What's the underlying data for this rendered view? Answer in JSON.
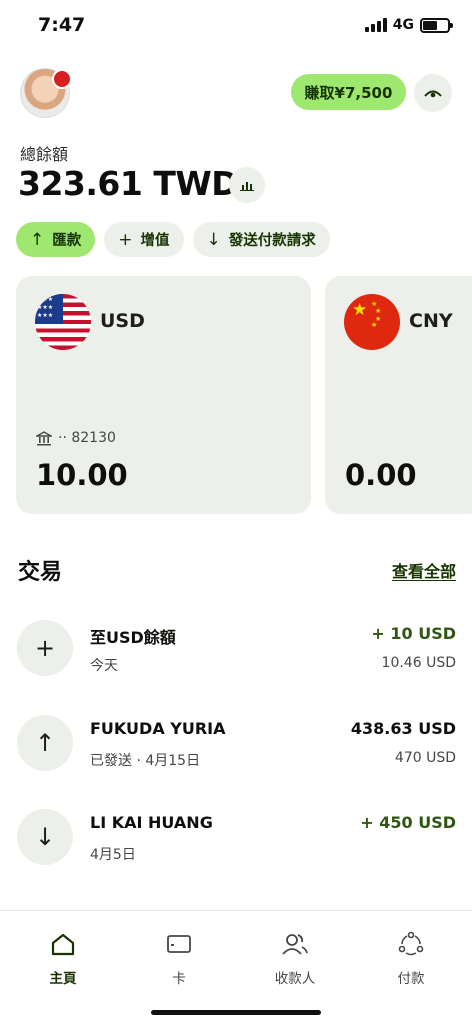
{
  "status_bar": {
    "time": "7:47",
    "network": "4G"
  },
  "header": {
    "earn_label": "賺取¥7,500"
  },
  "balance": {
    "label": "總餘額",
    "amount": "323.61 TWD"
  },
  "actions": [
    {
      "icon": "arrow-up-icon",
      "glyph": "↑",
      "label": "匯款"
    },
    {
      "icon": "plus-icon",
      "glyph": "+",
      "label": "增值"
    },
    {
      "icon": "arrow-down-icon",
      "glyph": "↓",
      "label": "發送付款請求"
    }
  ],
  "accounts": [
    {
      "currency": "USD",
      "bank_suffix": "·· 82130",
      "amount": "10.00"
    },
    {
      "currency": "CNY",
      "amount": "0.00"
    }
  ],
  "transactions": {
    "title": "交易",
    "see_all": "查看全部",
    "items": [
      {
        "icon": "plus-icon",
        "glyph": "+",
        "name": "至USD餘額",
        "subtitle": "今天",
        "amount": "+ 10 USD",
        "amount_secondary": "10.46 USD"
      },
      {
        "icon": "arrow-up-icon",
        "glyph": "↑",
        "name": "FUKUDA YURIA",
        "subtitle": "已發送 · 4月15日",
        "amount": "438.63 USD",
        "amount_secondary": "470 USD"
      },
      {
        "icon": "arrow-down-icon",
        "glyph": "↓",
        "name": "LI KAI HUANG",
        "subtitle": "4月5日",
        "amount": "+ 450 USD",
        "amount_secondary": ""
      }
    ]
  },
  "nav": [
    {
      "icon": "home-icon",
      "label": "主頁"
    },
    {
      "icon": "card-icon",
      "label": "卡"
    },
    {
      "icon": "recipients-icon",
      "label": "收款人"
    },
    {
      "icon": "payments-icon",
      "label": "付款"
    }
  ],
  "colors": {
    "accent": "#9fe870",
    "brand_dark": "#163300",
    "surface": "#ecefea",
    "positive": "#2f5711"
  }
}
